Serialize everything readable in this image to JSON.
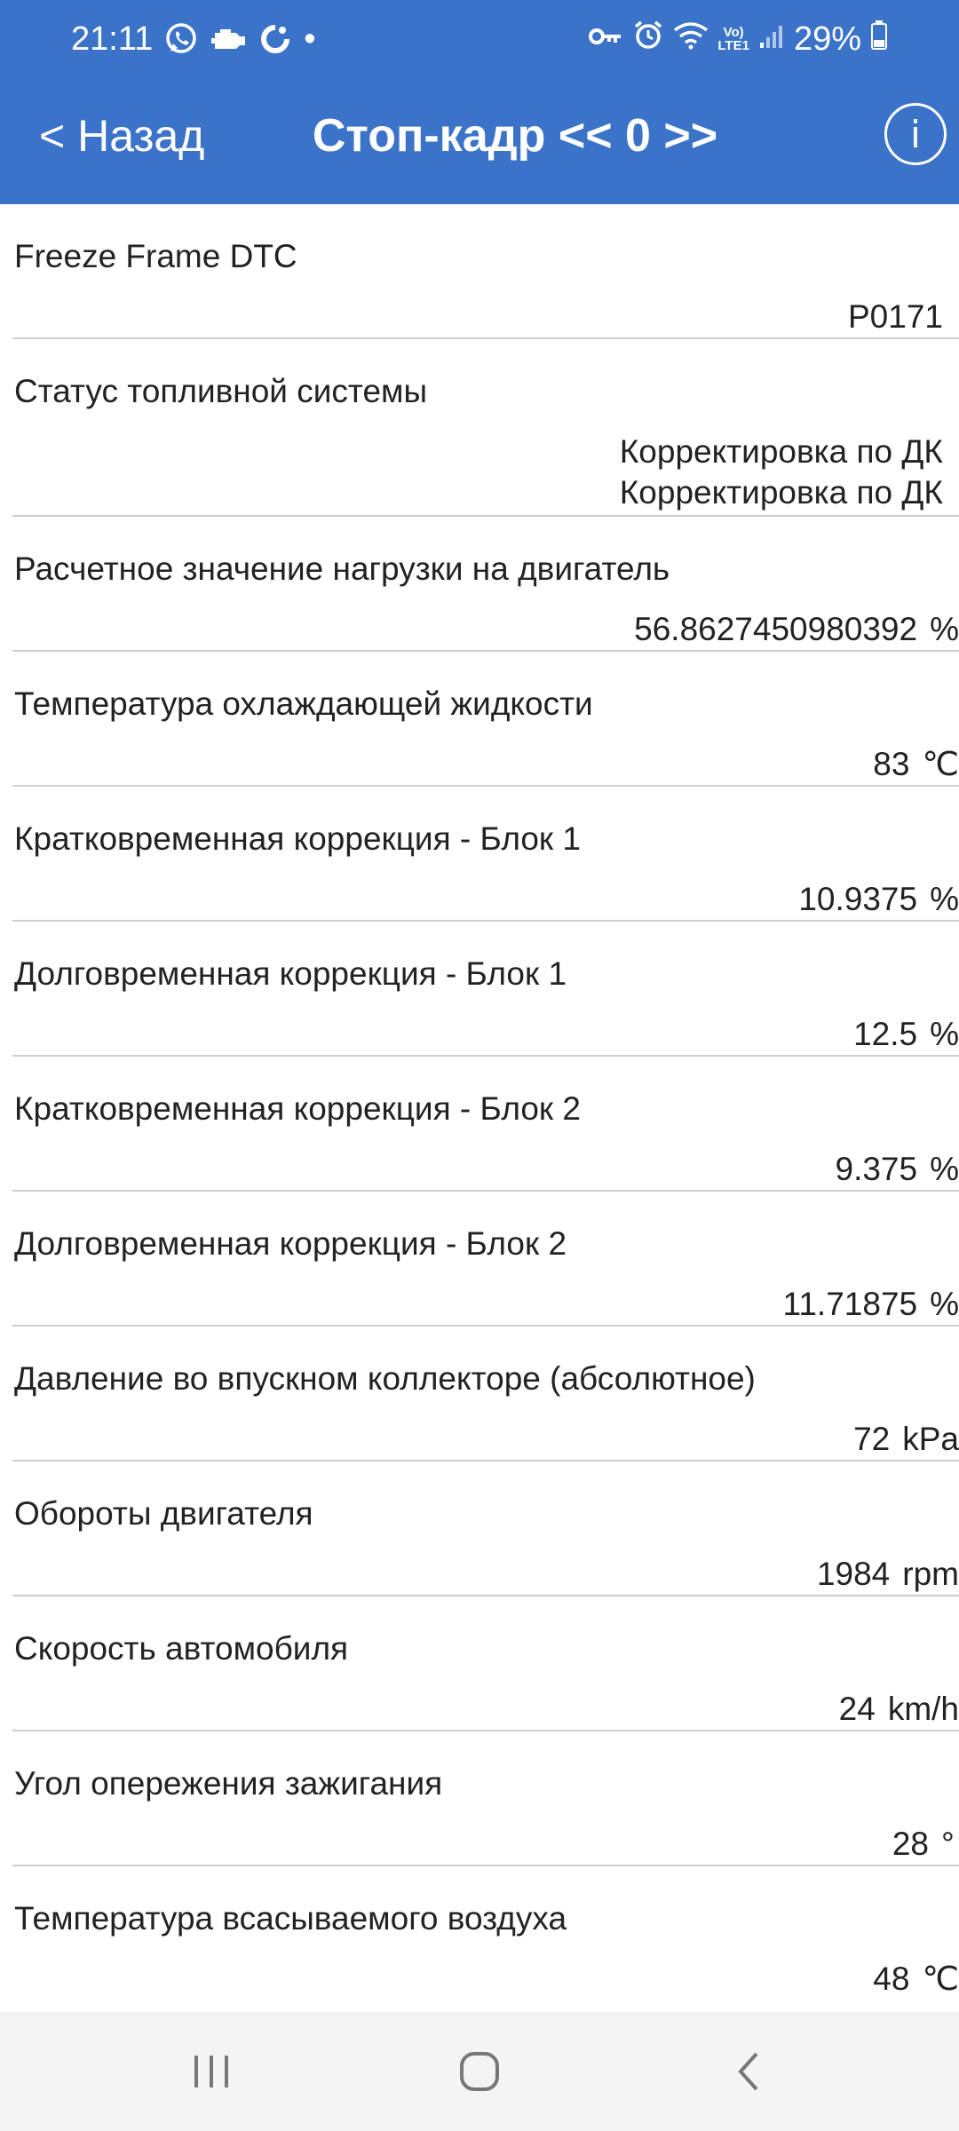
{
  "status_bar": {
    "time": "21:11",
    "dot": "•",
    "volte_top": "Vo)",
    "volte_bottom": "LTE1",
    "battery": "29%",
    "icons": [
      "whatsapp-icon",
      "check-engine-icon",
      "app-icon",
      "key-icon",
      "alarm-icon",
      "wifi-icon",
      "signal-icon",
      "battery-icon"
    ]
  },
  "toolbar": {
    "back_label": "< Назад",
    "title": "Стоп-кадр << 0 >>",
    "info_label": "i"
  },
  "colors": {
    "header": "#3b73c9",
    "divider": "#cfcfcf",
    "navbar": "#f4f4f4"
  },
  "params": [
    {
      "label": "Freeze Frame DTC",
      "values": [
        "P0171"
      ],
      "unit": ""
    },
    {
      "label": "Статус топливной системы",
      "values": [
        "Корректировка по ДК",
        "Корректировка по ДК"
      ],
      "unit": ""
    },
    {
      "label": "Расчетное значение нагрузки на двигатель",
      "values": [
        "56.8627450980392"
      ],
      "unit": "%"
    },
    {
      "label": "Температура охлаждающей жидкости",
      "values": [
        "83"
      ],
      "unit": "℃"
    },
    {
      "label": "Кратковременная коррекция - Блок 1",
      "values": [
        "10.9375"
      ],
      "unit": "%"
    },
    {
      "label": "Долговременная коррекция - Блок 1",
      "values": [
        "12.5"
      ],
      "unit": "%"
    },
    {
      "label": "Кратковременная коррекция - Блок 2",
      "values": [
        "9.375"
      ],
      "unit": "%"
    },
    {
      "label": "Долговременная коррекция - Блок 2",
      "values": [
        "11.71875"
      ],
      "unit": "%"
    },
    {
      "label": "Давление во впускном коллекторе (абсолютное)",
      "values": [
        "72"
      ],
      "unit": "kPa"
    },
    {
      "label": "Обороты двигателя",
      "values": [
        "1984"
      ],
      "unit": "rpm"
    },
    {
      "label": "Скорость автомобиля",
      "values": [
        "24"
      ],
      "unit": "km/h"
    },
    {
      "label": "Угол опережения зажигания",
      "values": [
        "28"
      ],
      "unit": "°"
    },
    {
      "label": "Температура всасываемого воздуха",
      "values": [
        "48"
      ],
      "unit": "℃"
    }
  ],
  "nav_bar": {
    "buttons": [
      "recents-icon",
      "home-icon",
      "back-icon"
    ]
  }
}
